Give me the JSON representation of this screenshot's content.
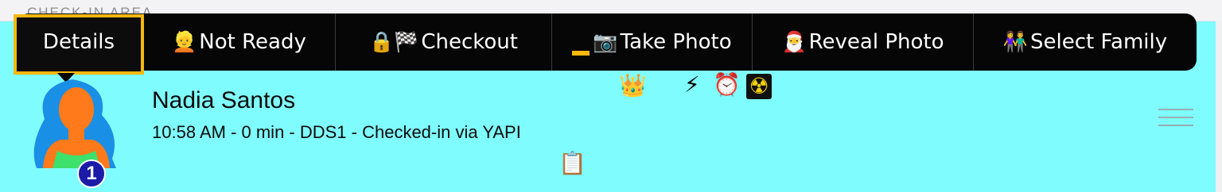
{
  "section": {
    "header": "CHECK-IN AREA"
  },
  "action_bar": {
    "details": {
      "label": "Details"
    },
    "not_ready": {
      "icon": "person-icon",
      "emoji": "👱",
      "label": "Not Ready"
    },
    "checkout": {
      "icon": "lock-icon",
      "emoji": "🔒🏁",
      "label": "Checkout"
    },
    "take_photo": {
      "icon": "camera-icon",
      "emoji": "📷",
      "label": "Take Photo"
    },
    "reveal_photo": {
      "icon": "santa-icon",
      "emoji": "🎅",
      "label": "Reveal Photo"
    },
    "select_family": {
      "icon": "family-icon",
      "emoji": "👫",
      "label": "Select Family"
    }
  },
  "patient": {
    "name": "Nadia Santos",
    "meta": "10:58 AM - 0 min - DDS1 - Checked-in via YAPI",
    "badge_number": "1"
  },
  "status_icons": {
    "crown": "👑",
    "lightning": "⚡",
    "alarm": "⏰",
    "radioactive": "☢",
    "clipboard": "📋"
  },
  "colors": {
    "background": "#7ffcfd",
    "bar": "#060606",
    "focus": "#f7b80f",
    "badge": "#1b1ba8"
  }
}
